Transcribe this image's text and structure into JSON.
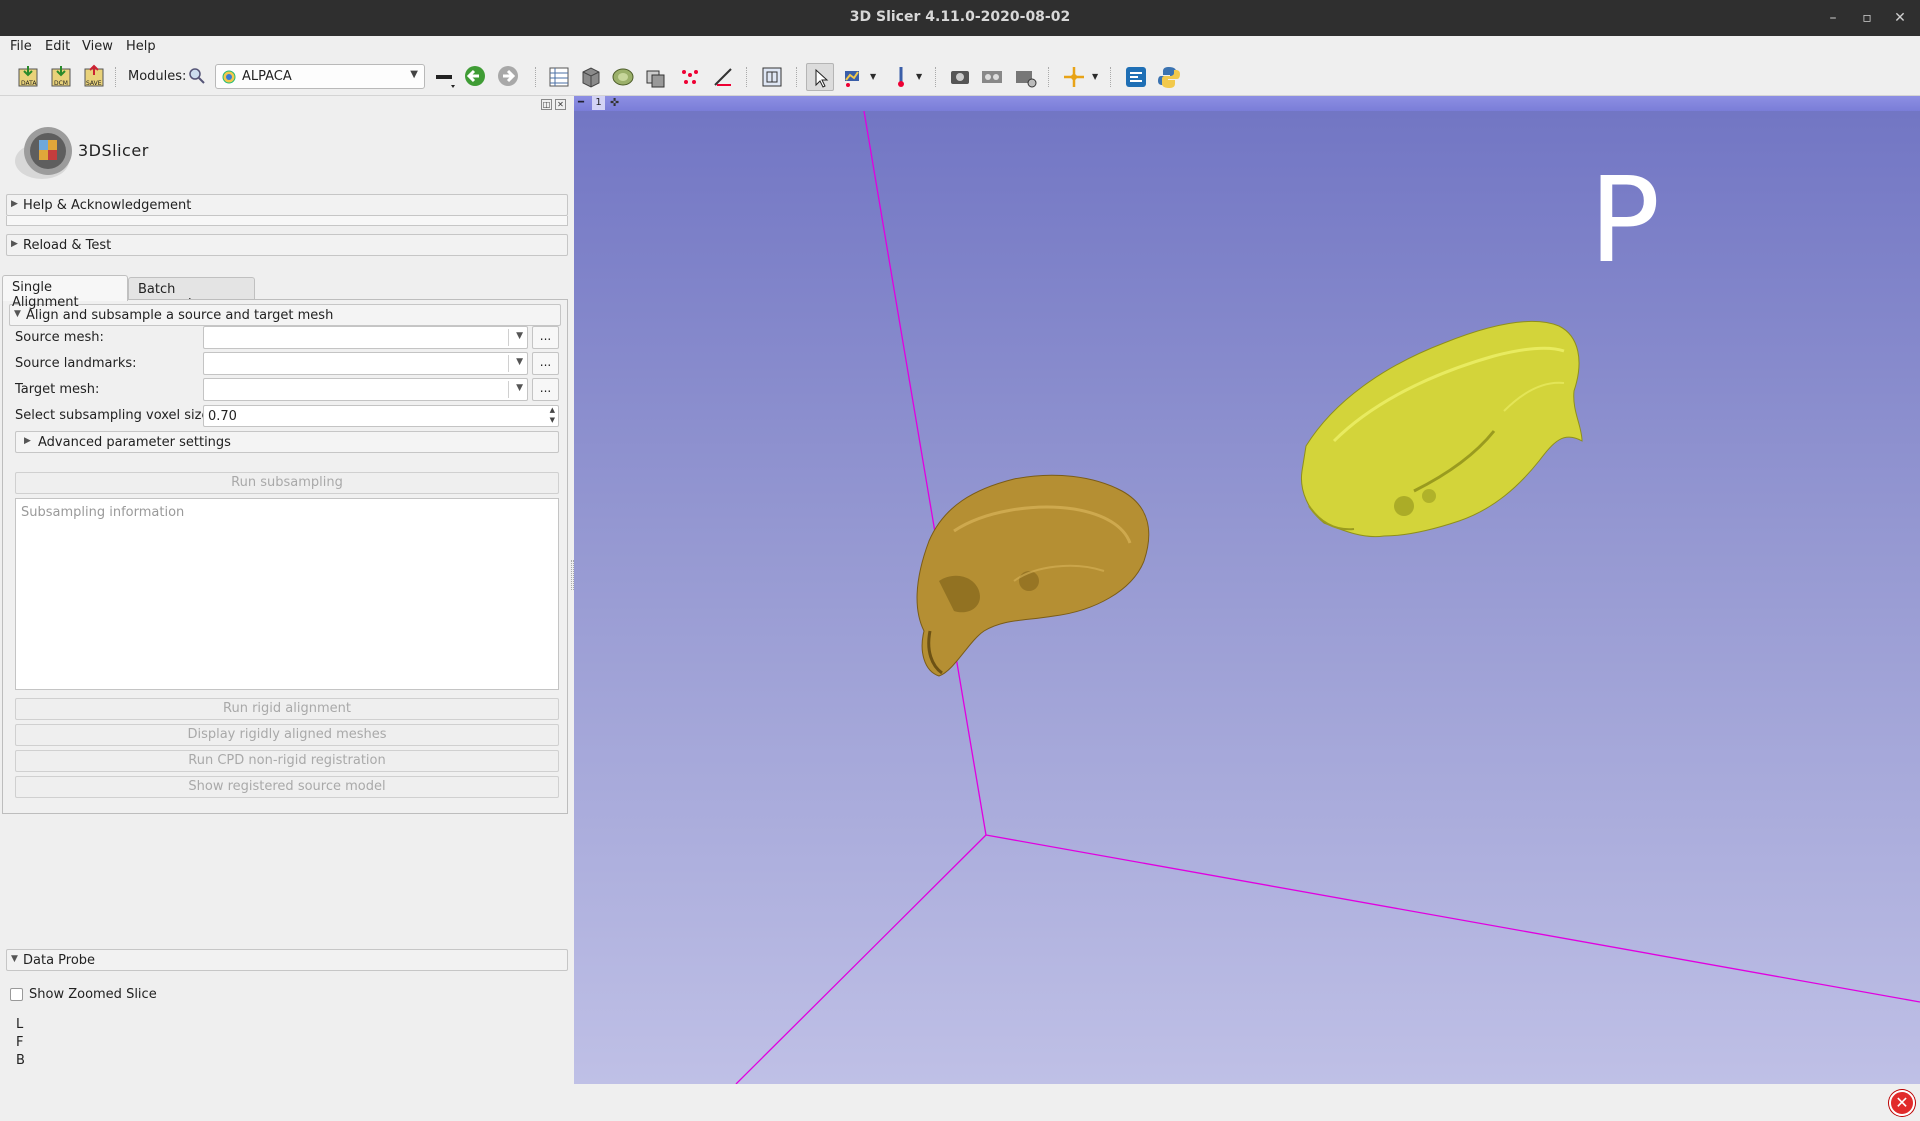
{
  "window": {
    "title": "3D Slicer 4.11.0-2020-08-02",
    "minimize_glyph": "–",
    "restore_glyph": "▫",
    "close_glyph": "✕"
  },
  "menubar": [
    "File",
    "Edit",
    "View",
    "Help"
  ],
  "toolbar": {
    "modules_label": "Modules:",
    "module_selected": "ALPACA",
    "icons": [
      "load-data-icon",
      "load-dicom-icon",
      "save-icon",
      "search-icon",
      "module-history-icon",
      "back-icon",
      "forward-icon",
      "layout-icon",
      "view-icon",
      "slice-icon",
      "crosshair-icon",
      "markups-icon",
      "python-icon"
    ]
  },
  "logo": {
    "text": "3DSlicer"
  },
  "sections": {
    "help": "Help & Acknowledgement",
    "reload": "Reload & Test",
    "data_probe": "Data Probe"
  },
  "tabs": [
    "Single Alignment",
    "Batch processing"
  ],
  "align_section": {
    "title": "Align and subsample a source and target mesh",
    "source_mesh_label": "Source mesh:",
    "source_landmarks_label": "Source landmarks:",
    "target_mesh_label": "Target mesh:",
    "voxel_label": "Select subsampling voxel size:",
    "voxel_value": "0.70",
    "advanced": "Advanced parameter settings",
    "browse": "...",
    "run_subsampling": "Run subsampling",
    "subsampling_placeholder": "Subsampling information",
    "run_rigid": "Run rigid alignment",
    "display_rigid": "Display rigidly aligned meshes",
    "run_cpd": "Run CPD non-rigid registration",
    "show_registered": "Show registered source model"
  },
  "data_probe": {
    "show_zoomed": "Show Zoomed Slice",
    "coords": [
      "L",
      "F",
      "B"
    ]
  },
  "view3d": {
    "view_number": "1",
    "orientation_letter": "P",
    "background_top": "#7276c4",
    "background_bottom": "#bfc0e6",
    "axis_color": "#e000e0",
    "source_skull_color": "#b89437",
    "target_skull_color": "#d2d43a"
  },
  "accent_colors": {
    "error": "#e12b2b"
  }
}
